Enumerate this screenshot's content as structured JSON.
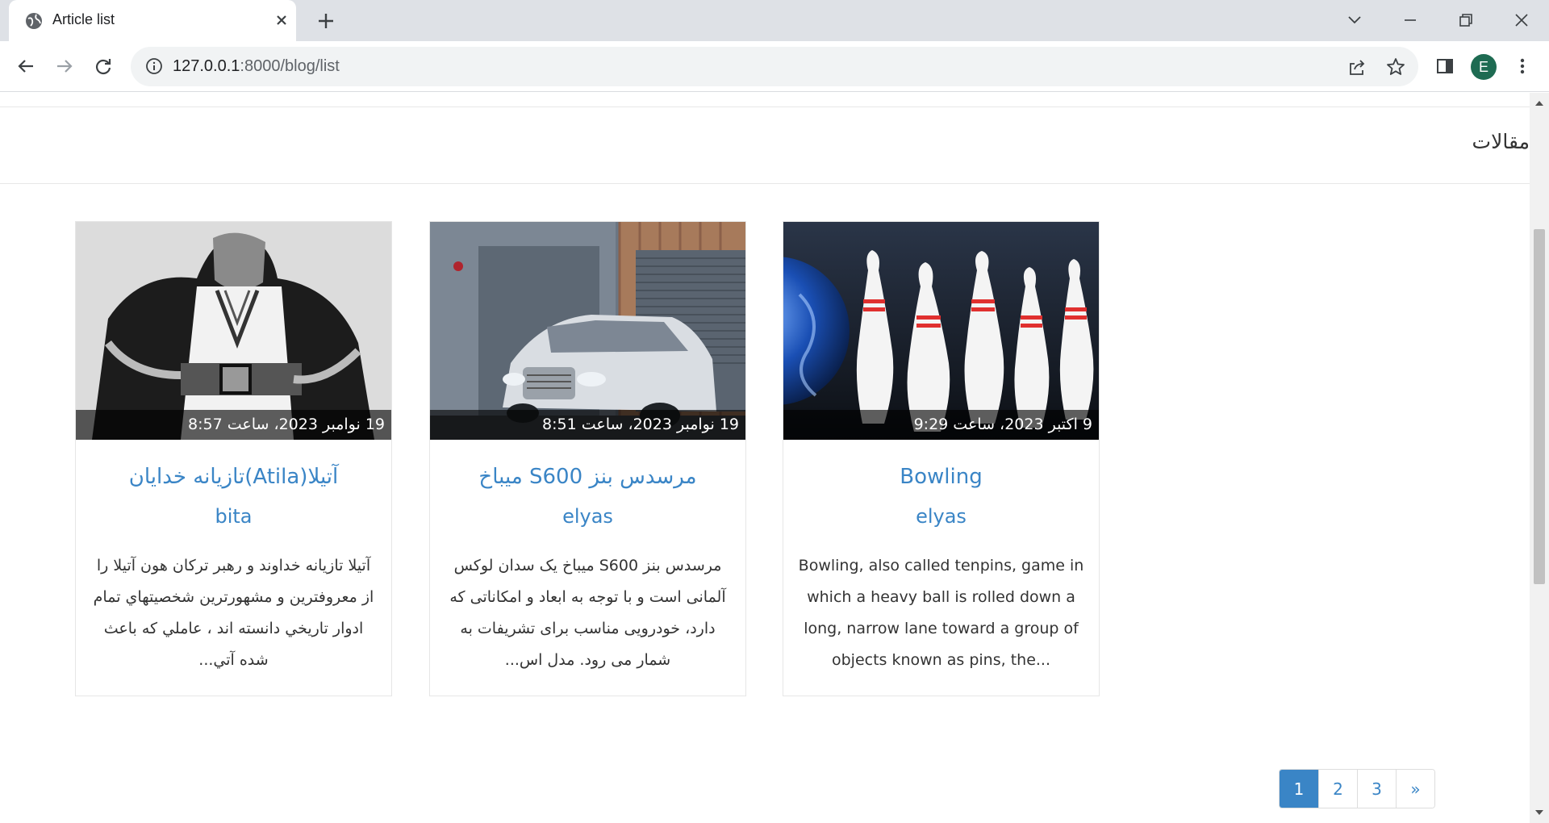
{
  "browser": {
    "tab_title": "Article list",
    "url_host": "127.0.0.1",
    "url_path": ":8000/blog/list",
    "profile_initial": "E"
  },
  "page": {
    "heading": "مقالات"
  },
  "articles": [
    {
      "date": "19 نوامبر 2023، ساعت 8:57",
      "title": "آتیلا(Atila)تازیانه خدایان",
      "author": "bita",
      "excerpt": "آتیلا تازیانه خداوند و رهبر ترکان هون آتيلا را از معروفترين و مشهورترين شخصيتهاي تمام ادوار تاريخي دانسته اند ، عاملي كه باعث شده آتي...",
      "rtl": true
    },
    {
      "date": "19 نوامبر 2023، ساعت 8:51",
      "title": "مرسدس بنز S600 میباخ",
      "author": "elyas",
      "excerpt": "مرسدس بنز S600 میباخ یک سدان لوکس آلمانی است و با توجه به ابعاد و امکاناتی که دارد، خودرویی مناسب برای تشریفات به شمار می رود. مدل اس...",
      "rtl": true
    },
    {
      "date": "9 اکتبر 2023، ساعت 9:29",
      "title": "Bowling",
      "author": "elyas",
      "excerpt": "Bowling, also called tenpins, game in which a heavy ball is rolled down a long, narrow lane toward a group of objects known as pins, the...",
      "rtl": false
    }
  ],
  "pagination": [
    "1",
    "2",
    "3",
    "»"
  ],
  "colors": {
    "link": "#3a85c6",
    "chrome_bg": "#dee1e6",
    "avatar": "#1e6b52"
  },
  "icons": {
    "tab_favicon": "globe-icon",
    "tab_close": "close-icon",
    "new_tab": "plus-icon",
    "back": "arrow-left-icon",
    "forward": "arrow-right-icon",
    "reload": "reload-icon",
    "site_info": "info-icon",
    "share": "share-icon",
    "bookmark": "star-icon",
    "side_panel": "side-panel-icon",
    "menu": "kebab-menu-icon"
  }
}
